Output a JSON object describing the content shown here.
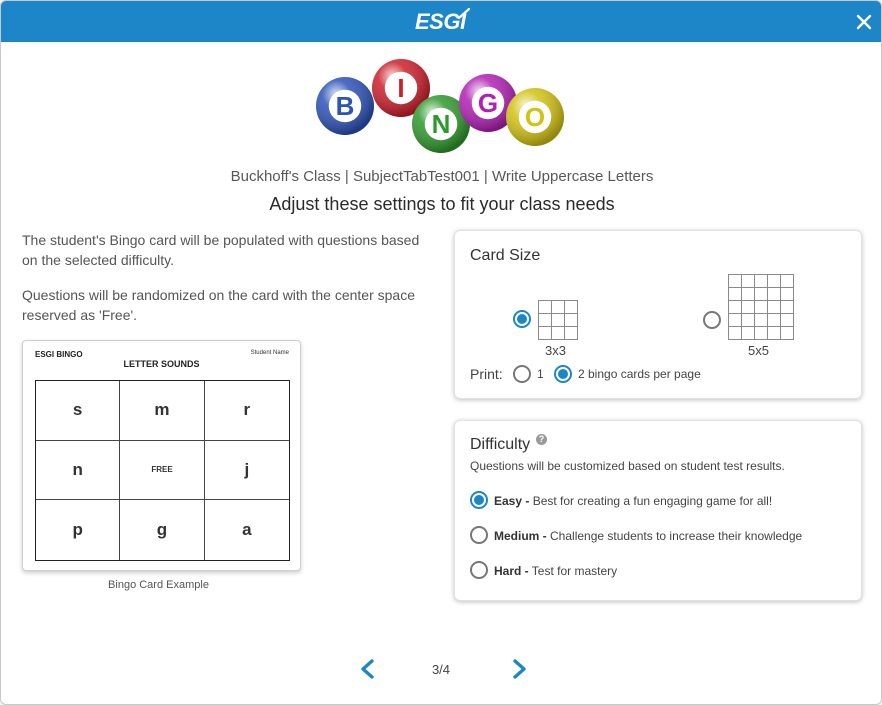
{
  "header": {
    "logo_text": "ESGI",
    "colors": {
      "header_bg": "#1c86c8",
      "accent": "#1c86c8"
    }
  },
  "bingo_logo": {
    "letters": [
      "B",
      "I",
      "N",
      "G",
      "O"
    ],
    "ball_colors": [
      "#2d52b8",
      "#cc1f2c",
      "#2f9a2c",
      "#b120b5",
      "#d2c214"
    ]
  },
  "subtitle": "Buckhoff's Class | SubjectTabTest001 | Write Uppercase Letters",
  "heading": "Adjust these settings to fit your class needs",
  "description": {
    "para1": "The student's Bingo card will be populated with questions based on the selected difficulty.",
    "para2": "Questions will be randomized on the card with the center space reserved as 'Free'."
  },
  "example_card": {
    "top_left": "ESGI BINGO",
    "top_right": "Student Name",
    "title": "LETTER SOUNDS",
    "cells": [
      "s",
      "m",
      "r",
      "n",
      "FREE",
      "j",
      "p",
      "g",
      "a"
    ],
    "caption": "Bingo Card Example"
  },
  "card_size": {
    "title": "Card Size",
    "options": [
      {
        "label": "3x3",
        "selected": true
      },
      {
        "label": "5x5",
        "selected": false
      }
    ],
    "print_label": "Print:",
    "print_options": [
      {
        "label": "1",
        "selected": false
      },
      {
        "label": "2 bingo cards per page",
        "selected": true
      }
    ]
  },
  "difficulty": {
    "title": "Difficulty",
    "help_icon": "question-circle-icon",
    "subtitle": "Questions will be customized based on student test results.",
    "options": [
      {
        "name": "Easy -",
        "description": "Best for creating a fun engaging game for all!",
        "selected": true
      },
      {
        "name": "Medium -",
        "description": "Challenge students to increase their knowledge",
        "selected": false
      },
      {
        "name": "Hard -",
        "description": "Test for mastery",
        "selected": false
      }
    ]
  },
  "pagination": {
    "current": 3,
    "total": 4,
    "text": "3/4"
  }
}
